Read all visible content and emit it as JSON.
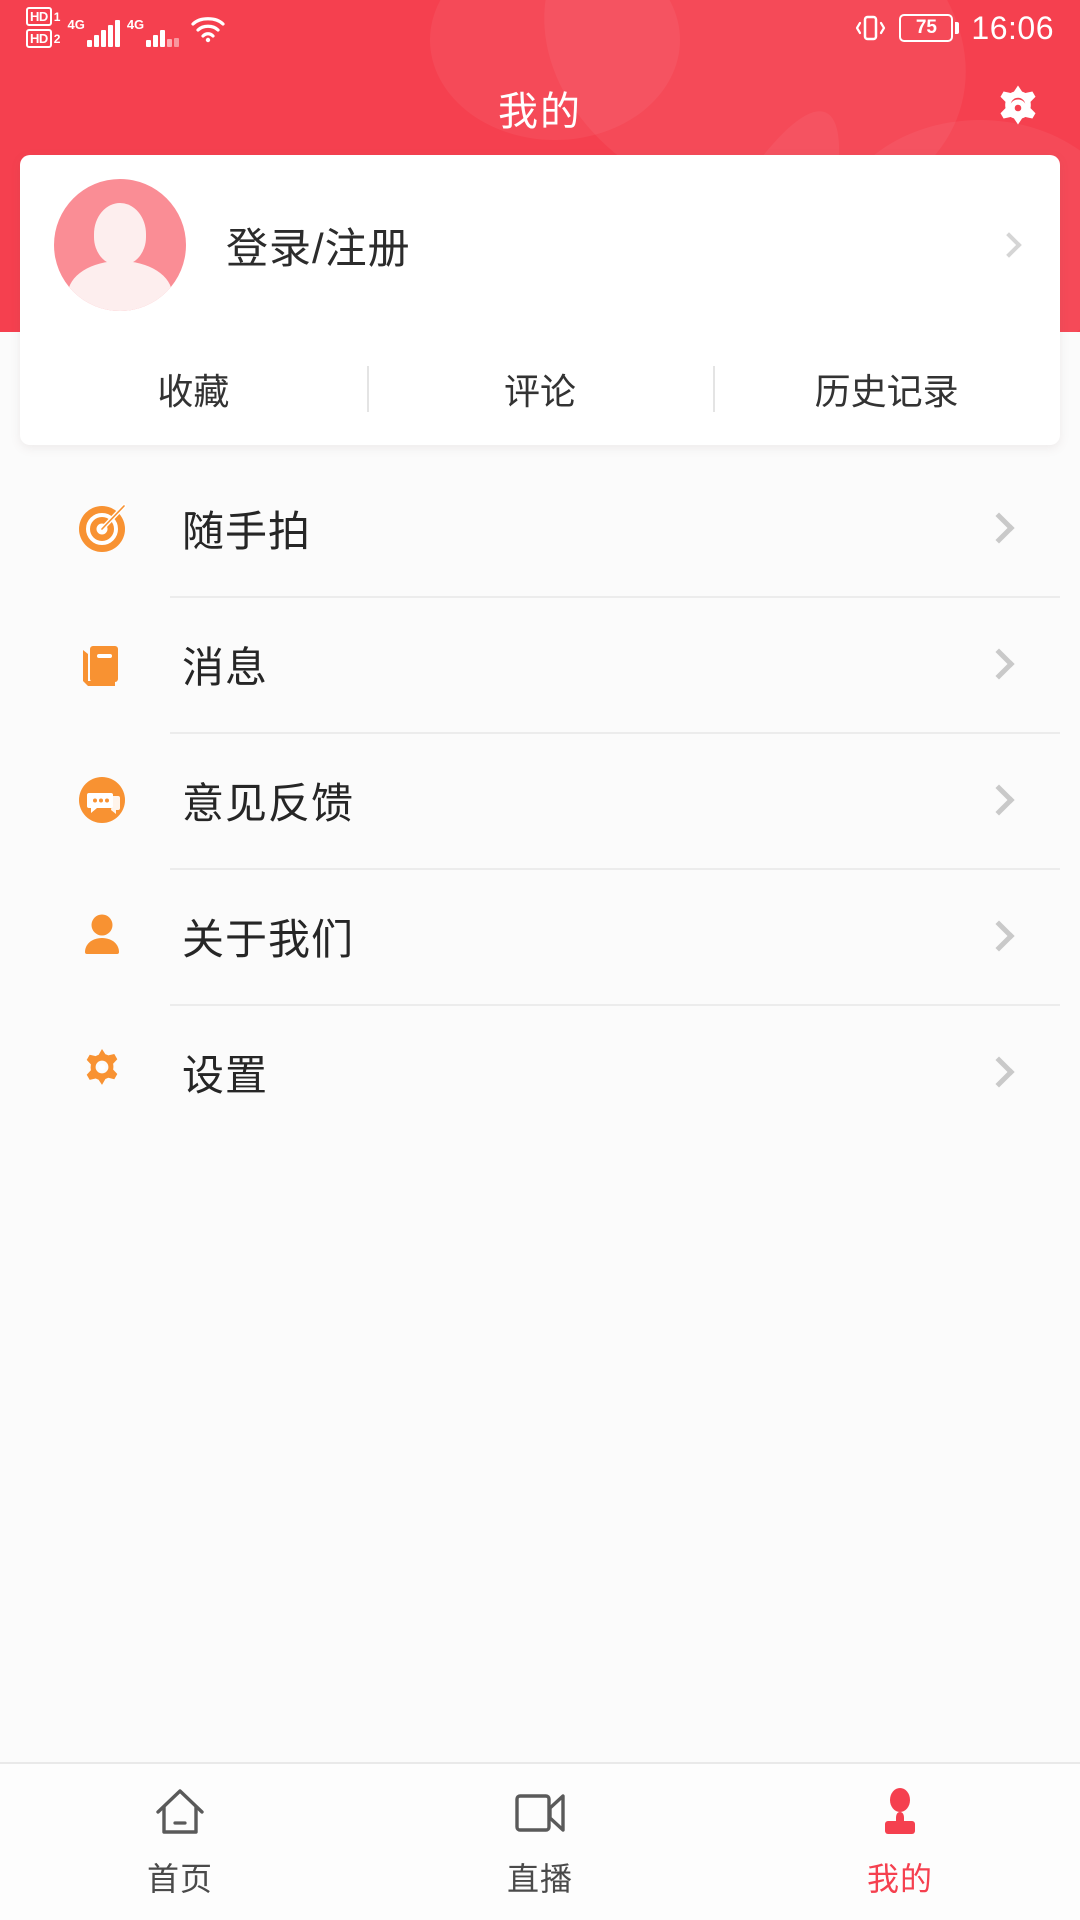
{
  "statusbar": {
    "hd1_label": "HD",
    "hd1_num": "1",
    "hd2_label": "HD",
    "hd2_num": "2",
    "network1": "4G",
    "network2": "4G",
    "wifi_icon": "wifi-icon",
    "vibrate_icon": "vibrate-icon",
    "battery_level": "75",
    "time": "16:06"
  },
  "header": {
    "title": "我的",
    "settings_icon": "gear-icon",
    "brand_color": "#f5404f"
  },
  "profile": {
    "avatar_icon": "avatar-placeholder",
    "login_label": "登录/注册",
    "chevron_icon": "chevron-right-icon"
  },
  "tabs": [
    {
      "label": "收藏",
      "name": "tab-favorites"
    },
    {
      "label": "评论",
      "name": "tab-comments"
    },
    {
      "label": "历史记录",
      "name": "tab-history"
    }
  ],
  "menu": [
    {
      "label": "随手拍",
      "icon": "target-camera-icon",
      "name": "menu-item-snapshot"
    },
    {
      "label": "消息",
      "icon": "book-message-icon",
      "name": "menu-item-messages"
    },
    {
      "label": "意见反馈",
      "icon": "chat-bubble-icon",
      "name": "menu-item-feedback"
    },
    {
      "label": "关于我们",
      "icon": "person-icon",
      "name": "menu-item-about"
    },
    {
      "label": "设置",
      "icon": "gear-icon",
      "name": "menu-item-settings"
    }
  ],
  "bottomnav": [
    {
      "label": "首页",
      "icon": "home-icon",
      "name": "nav-home",
      "active": false
    },
    {
      "label": "直播",
      "icon": "video-camera-icon",
      "name": "nav-live",
      "active": false
    },
    {
      "label": "我的",
      "icon": "person-icon",
      "name": "nav-mine",
      "active": true
    }
  ],
  "colors": {
    "accent_red": "#f5404f",
    "icon_orange": "#f89232",
    "text_dark": "#262626",
    "text_gray": "#4a4a4a"
  }
}
